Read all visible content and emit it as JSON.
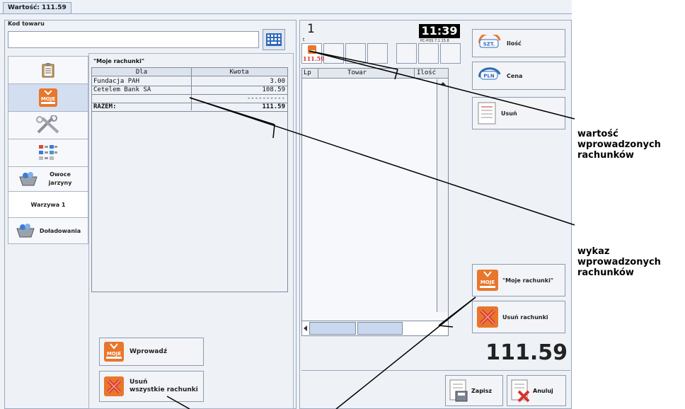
{
  "window": {
    "tab_label": "Wartość: 111.59"
  },
  "left": {
    "code_legend": "Kod towaru",
    "code_value": "",
    "keypad_icon": "keypad-icon",
    "tabs": [
      {
        "label": "",
        "icon": "clipboard-icon"
      },
      {
        "label": "",
        "icon": "moje-rachunki-icon"
      },
      {
        "label": "",
        "icon": "tools-icon"
      },
      {
        "label": "",
        "icon": "grid-list-icon"
      },
      {
        "label": "Owoce jarzyny",
        "icon": "basket-icon"
      },
      {
        "label": "Warzywa 1",
        "icon": ""
      },
      {
        "label": "Doładowania",
        "icon": "basket-icon"
      }
    ],
    "bills": {
      "title": "\"Moje rachunki\"",
      "col_for": "Dla",
      "col_amount": "Kwota",
      "rows": [
        {
          "name": "Fundacja PAH",
          "amount": "3.00"
        },
        {
          "name": "Cetelem Bank SA",
          "amount": "108.59"
        }
      ],
      "separator": "----------",
      "total_label": "RAZEM:",
      "total_value": "111.59"
    },
    "enter_button": "Wprowadź",
    "delete_all_button_line1": "Usuń",
    "delete_all_button_line2": "wszystkie rachunki"
  },
  "right": {
    "seq_number": "1",
    "seq_sub": "t",
    "clock": "11:39",
    "version": "PC-POS 7.1.15.8",
    "bill_slot_value": "111.59",
    "table_cols": {
      "lp": "Lp",
      "product": "Towar",
      "qty": "Ilość"
    },
    "qty_button": "Ilość",
    "qty_badge": "SZT.",
    "price_button": "Cena",
    "price_badge": "PLN",
    "delete_button": "Usuń",
    "my_bills_button": "\"Moje rachunki\"",
    "delete_bill_button": "Usuń rachunki",
    "total": "111.59",
    "save_button": "Zapisz",
    "cancel_button": "Anuluj"
  },
  "annotations": {
    "value_label": [
      "wartość",
      "wprowadzonych",
      "rachunków"
    ],
    "list_label": [
      "wykaz",
      "wprowadzonych",
      "rachunków"
    ]
  },
  "colors": {
    "accent_orange": "#e8762b",
    "cancel_red": "#d6332b",
    "frame_blue": "#8fa6c5"
  }
}
